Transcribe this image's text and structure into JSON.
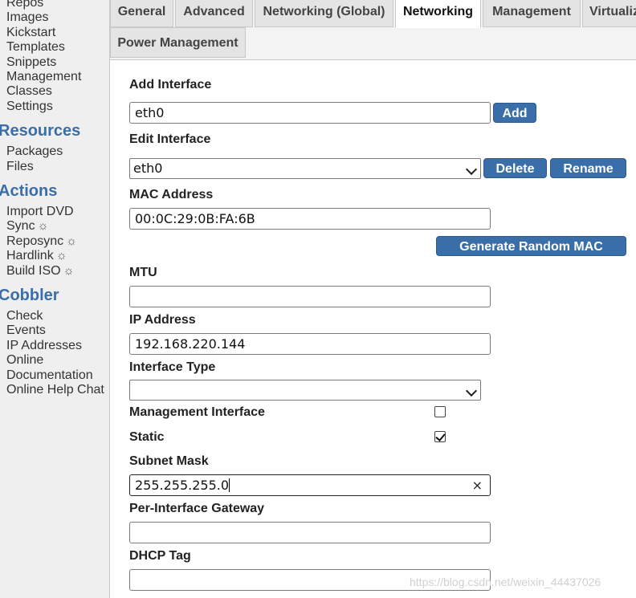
{
  "sidebar": {
    "links_top": [
      "Repos",
      "Images",
      "Kickstart Templates",
      "Snippets",
      "Management Classes",
      "Settings"
    ],
    "kickstart_line1": "Kickstart",
    "kickstart_line2": "Templates",
    "management_line1": "Management",
    "management_line2": "Classes",
    "resources_heading": "Resources",
    "resources": [
      "Packages",
      "Files"
    ],
    "actions_heading": "Actions",
    "actions": [
      "Import DVD",
      "Sync",
      "Reposync",
      "Hardlink",
      "Build ISO"
    ],
    "action_icon": "sun-icon",
    "cobbler_heading": "Cobbler",
    "cobbler": [
      "Check",
      "Events",
      "IP Addresses",
      "Online Documentation",
      "Online Help Chat"
    ],
    "online_line1": "Online",
    "online_line2": "Documentation"
  },
  "tabs": {
    "row1": [
      "General",
      "Advanced",
      "Networking (Global)",
      "Networking",
      "Management",
      "Virtualiz"
    ],
    "row2": [
      "Power Management"
    ],
    "active": "Networking"
  },
  "form": {
    "add_interface": {
      "label": "Add Interface",
      "value": "eth0",
      "button": "Add"
    },
    "edit_interface": {
      "label": "Edit Interface",
      "selected": "eth0",
      "delete": "Delete",
      "rename": "Rename"
    },
    "mac_address": {
      "label": "MAC Address",
      "value": "00:0C:29:0B:FA:6B",
      "button": "Generate Random MAC"
    },
    "mtu": {
      "label": "MTU",
      "value": ""
    },
    "ip_address": {
      "label": "IP Address",
      "value": "192.168.220.144"
    },
    "interface_type": {
      "label": "Interface Type",
      "selected": ""
    },
    "management_interface": {
      "label": "Management Interface",
      "checked": false
    },
    "static": {
      "label": "Static",
      "checked": true
    },
    "subnet_mask": {
      "label": "Subnet Mask",
      "value": "255.255.255.0",
      "clear": "×"
    },
    "gateway": {
      "label": "Per-Interface Gateway",
      "value": ""
    },
    "dhcp_tag": {
      "label": "DHCP Tag",
      "value": ""
    }
  },
  "watermark": "https://blog.csdn.net/weixin_44437026"
}
